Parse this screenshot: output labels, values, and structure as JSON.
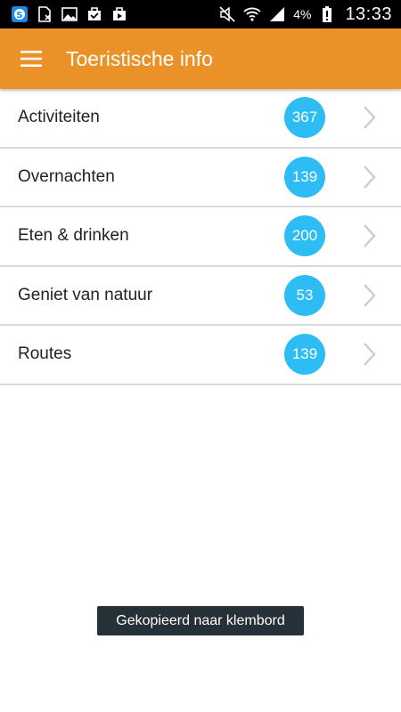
{
  "status_bar": {
    "icons_left": [
      "skype-icon",
      "sim-card-icon",
      "image-icon",
      "clipboard-check-icon",
      "play-store-icon"
    ],
    "icons_right": [
      "mute-icon",
      "wifi-icon",
      "signal-icon",
      "battery-alert-icon"
    ],
    "battery_percent": "4%",
    "time": "13:33"
  },
  "app_bar": {
    "title": "Toeristische info",
    "menu_icon": "hamburger-menu-icon",
    "background_color": "#ea9128"
  },
  "list": {
    "items": [
      {
        "label": "Activiteiten",
        "count": "367"
      },
      {
        "label": "Overnachten",
        "count": "139"
      },
      {
        "label": "Eten & drinken",
        "count": "200"
      },
      {
        "label": "Geniet van natuur",
        "count": "53"
      },
      {
        "label": "Routes",
        "count": "139"
      }
    ],
    "badge_color": "#2dbdf4",
    "chevron_icon": "chevron-right-icon"
  },
  "toast": {
    "text": "Gekopieerd naar klembord"
  }
}
